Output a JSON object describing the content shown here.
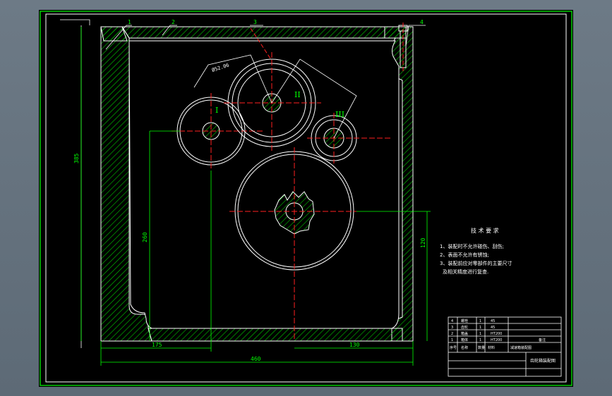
{
  "drawing": {
    "colors": {
      "background": "#000000",
      "outline": "#ffffff",
      "frame": "#00ff00",
      "centerline": "#ff2020",
      "hatch": "#00cc00",
      "dimension": "#00ff00",
      "window_bg": "#66737f"
    },
    "part_labels": [
      "1",
      "2",
      "3",
      "4"
    ],
    "gear_labels": [
      "I",
      "II",
      "III"
    ],
    "angle_dim": "Ø52.06",
    "dimensions": {
      "height_left": "385",
      "height_inner": "260",
      "height_right": "120",
      "width_bottom_left": "175",
      "width_bottom_right": "130",
      "width_total": "460"
    },
    "tech_notes": {
      "title": "技 术 要 求",
      "lines": [
        "1、装配时不允许碰伤、刮伤;",
        "2、表面不允许有锈蚀;",
        "3、装配前应对零部件的主要尺寸",
        "及相关精度进行复查."
      ]
    },
    "title_block": {
      "rows": [
        [
          "4",
          "螺栓",
          "1",
          "45"
        ],
        [
          "3",
          "齿轮",
          "1",
          "45"
        ],
        [
          "2",
          "箱盖",
          "1",
          "HT200"
        ],
        [
          "1",
          "箱体",
          "1",
          "HT200"
        ]
      ],
      "header": [
        "序号",
        "名称",
        "数量",
        "材料"
      ],
      "label_assembly": "减速箱装配图",
      "label_remarks": "备注",
      "drawing_name": "齿轮箱装配图"
    }
  }
}
